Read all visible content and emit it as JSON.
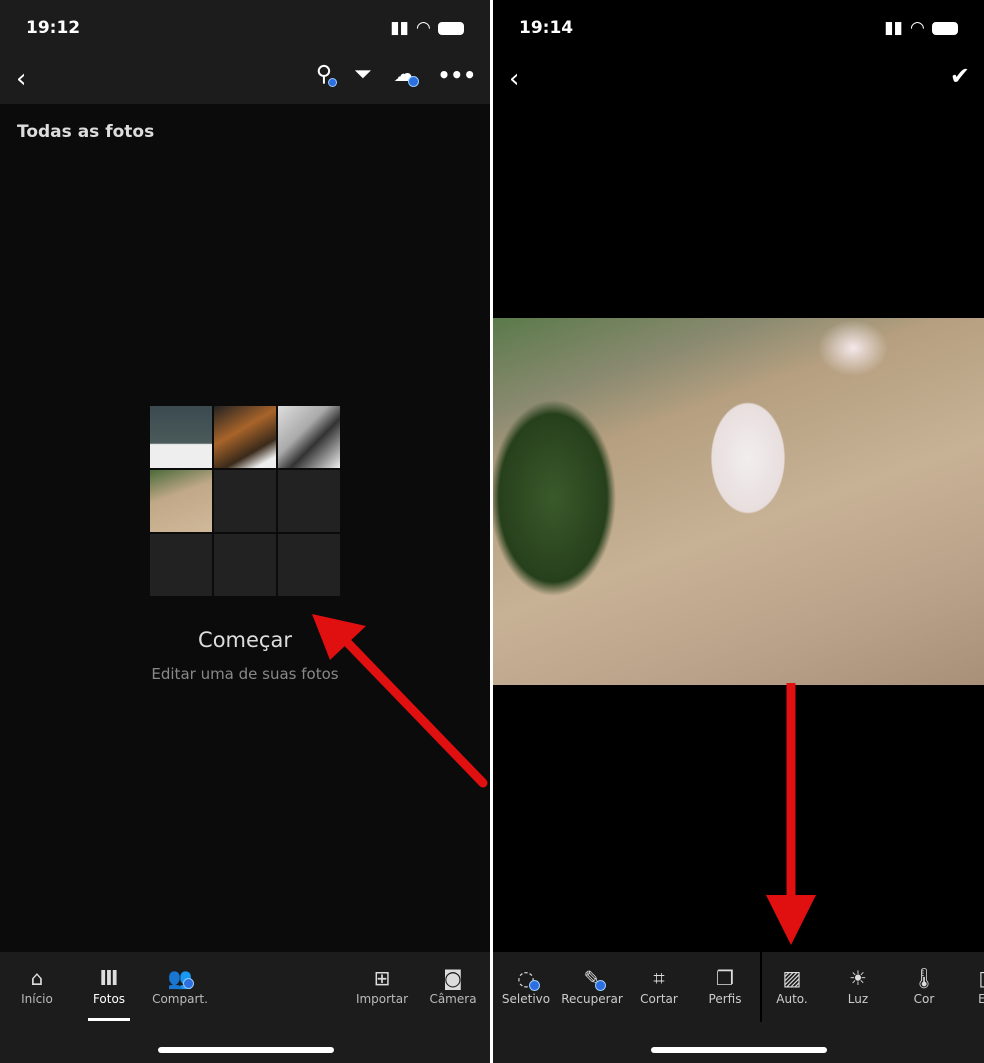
{
  "left": {
    "status": {
      "time": "19:12"
    },
    "toolbar": {
      "icons": [
        "back-chevron",
        "people-search",
        "filter",
        "cloud-sync",
        "more"
      ]
    },
    "section_title": "Todas as fotos",
    "empty_state": {
      "title": "Começar",
      "subtitle": "Editar uma de suas fotos"
    },
    "tabs": [
      {
        "label": "Início",
        "icon": "home"
      },
      {
        "label": "Fotos",
        "icon": "library",
        "active": true
      },
      {
        "label": "Compart.",
        "icon": "people"
      },
      {
        "label": "Importar",
        "icon": "import-image"
      },
      {
        "label": "Câmera",
        "icon": "camera"
      }
    ]
  },
  "right": {
    "status": {
      "time": "19:14"
    },
    "toolbar": {
      "icons": [
        "back-chevron",
        "checkmark"
      ]
    },
    "tools": [
      {
        "label": "Seletivo"
      },
      {
        "label": "Recuperar"
      },
      {
        "label": "Cortar"
      },
      {
        "label": "Perfis"
      },
      {
        "label": "Auto."
      },
      {
        "label": "Luz"
      },
      {
        "label": "Cor"
      },
      {
        "label": "Ef"
      }
    ]
  },
  "colors": {
    "accent": "#2d6fe0",
    "arrow": "#e01010"
  }
}
